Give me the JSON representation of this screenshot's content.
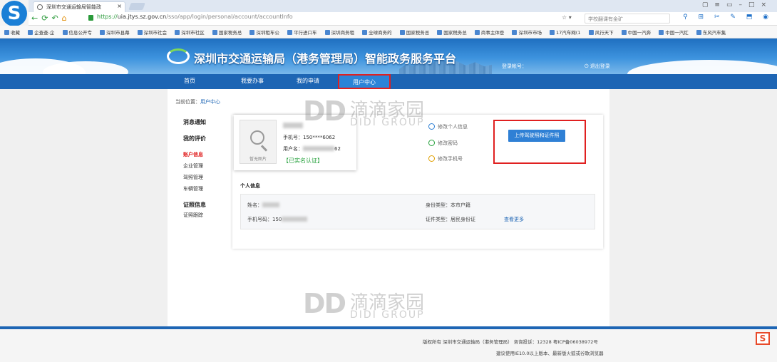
{
  "browser": {
    "tab_title": "深圳市交通运输局智能政",
    "url_scheme": "https://",
    "url_host": "uia.jtys.sz.gov.cn",
    "url_path": "/sso/app/login/personal/account/accountInfo",
    "search_placeholder": "学校翻课有金矿",
    "bookmarks": [
      "收藏",
      "企查查-企",
      "信息公开专",
      "深圳市县幕",
      "深圳市社会",
      "深圳市社区",
      "国家税务总",
      "深圳租车公",
      "平行进口车",
      "深圳商务租",
      "全球商务的",
      "国家税务总",
      "国家税务总",
      "商事主体登",
      "深圳市市场",
      "17汽车网(1",
      "风行天下",
      "中国一汽奔",
      "中国一汽红",
      "东风汽车集"
    ]
  },
  "site": {
    "title": "深圳市交通运输局（港务管理局）智能政务服务平台",
    "login_account_label": "登录帐号：",
    "logout_label": "退出登录",
    "nav": [
      "首页",
      "我要办事",
      "我的申请",
      "用户中心"
    ]
  },
  "breadcrumb": {
    "prefix": "当前位置：",
    "current": "用户中心"
  },
  "sidebar": {
    "messages": "消息通知",
    "reviews": "我的评价",
    "account": "账户信息",
    "enterprise": "企业管理",
    "driver": "驾照管理",
    "vehicle": "车辆管理",
    "cert_header": "证照信息",
    "cert_track": "证照跟踪"
  },
  "profile": {
    "avatar_caption": "暂无图片",
    "phone_label": "手机号：",
    "phone": "150****6062",
    "username_label": "用户名：",
    "username_tail": "62",
    "verified": "【已实名认证】",
    "actions": [
      "修改个人信息",
      "修改密码",
      "修改手机号"
    ],
    "upload_button": "上传驾驶照和证件照"
  },
  "personal_info": {
    "title": "个人信息",
    "name_label": "姓名：",
    "phone_label": "手机号码：",
    "phone_prefix": "150",
    "id_type_label": "身份类型：",
    "id_type": "本市户籍",
    "cert_type_label": "证件类型：",
    "cert_type": "居民身份证",
    "more": "查看更多"
  },
  "watermark": {
    "logo": "DD",
    "cn": "滴滴家园",
    "en": "DIDI GROUP"
  },
  "footer": {
    "copyright": "版权所有 深圳市交通运输局（港务管理局） 咨询投诉：12328 粤ICP备06038972号",
    "browser_tip": "建议使用IE10.0以上版本、最新版火狐或谷歌浏览器"
  }
}
